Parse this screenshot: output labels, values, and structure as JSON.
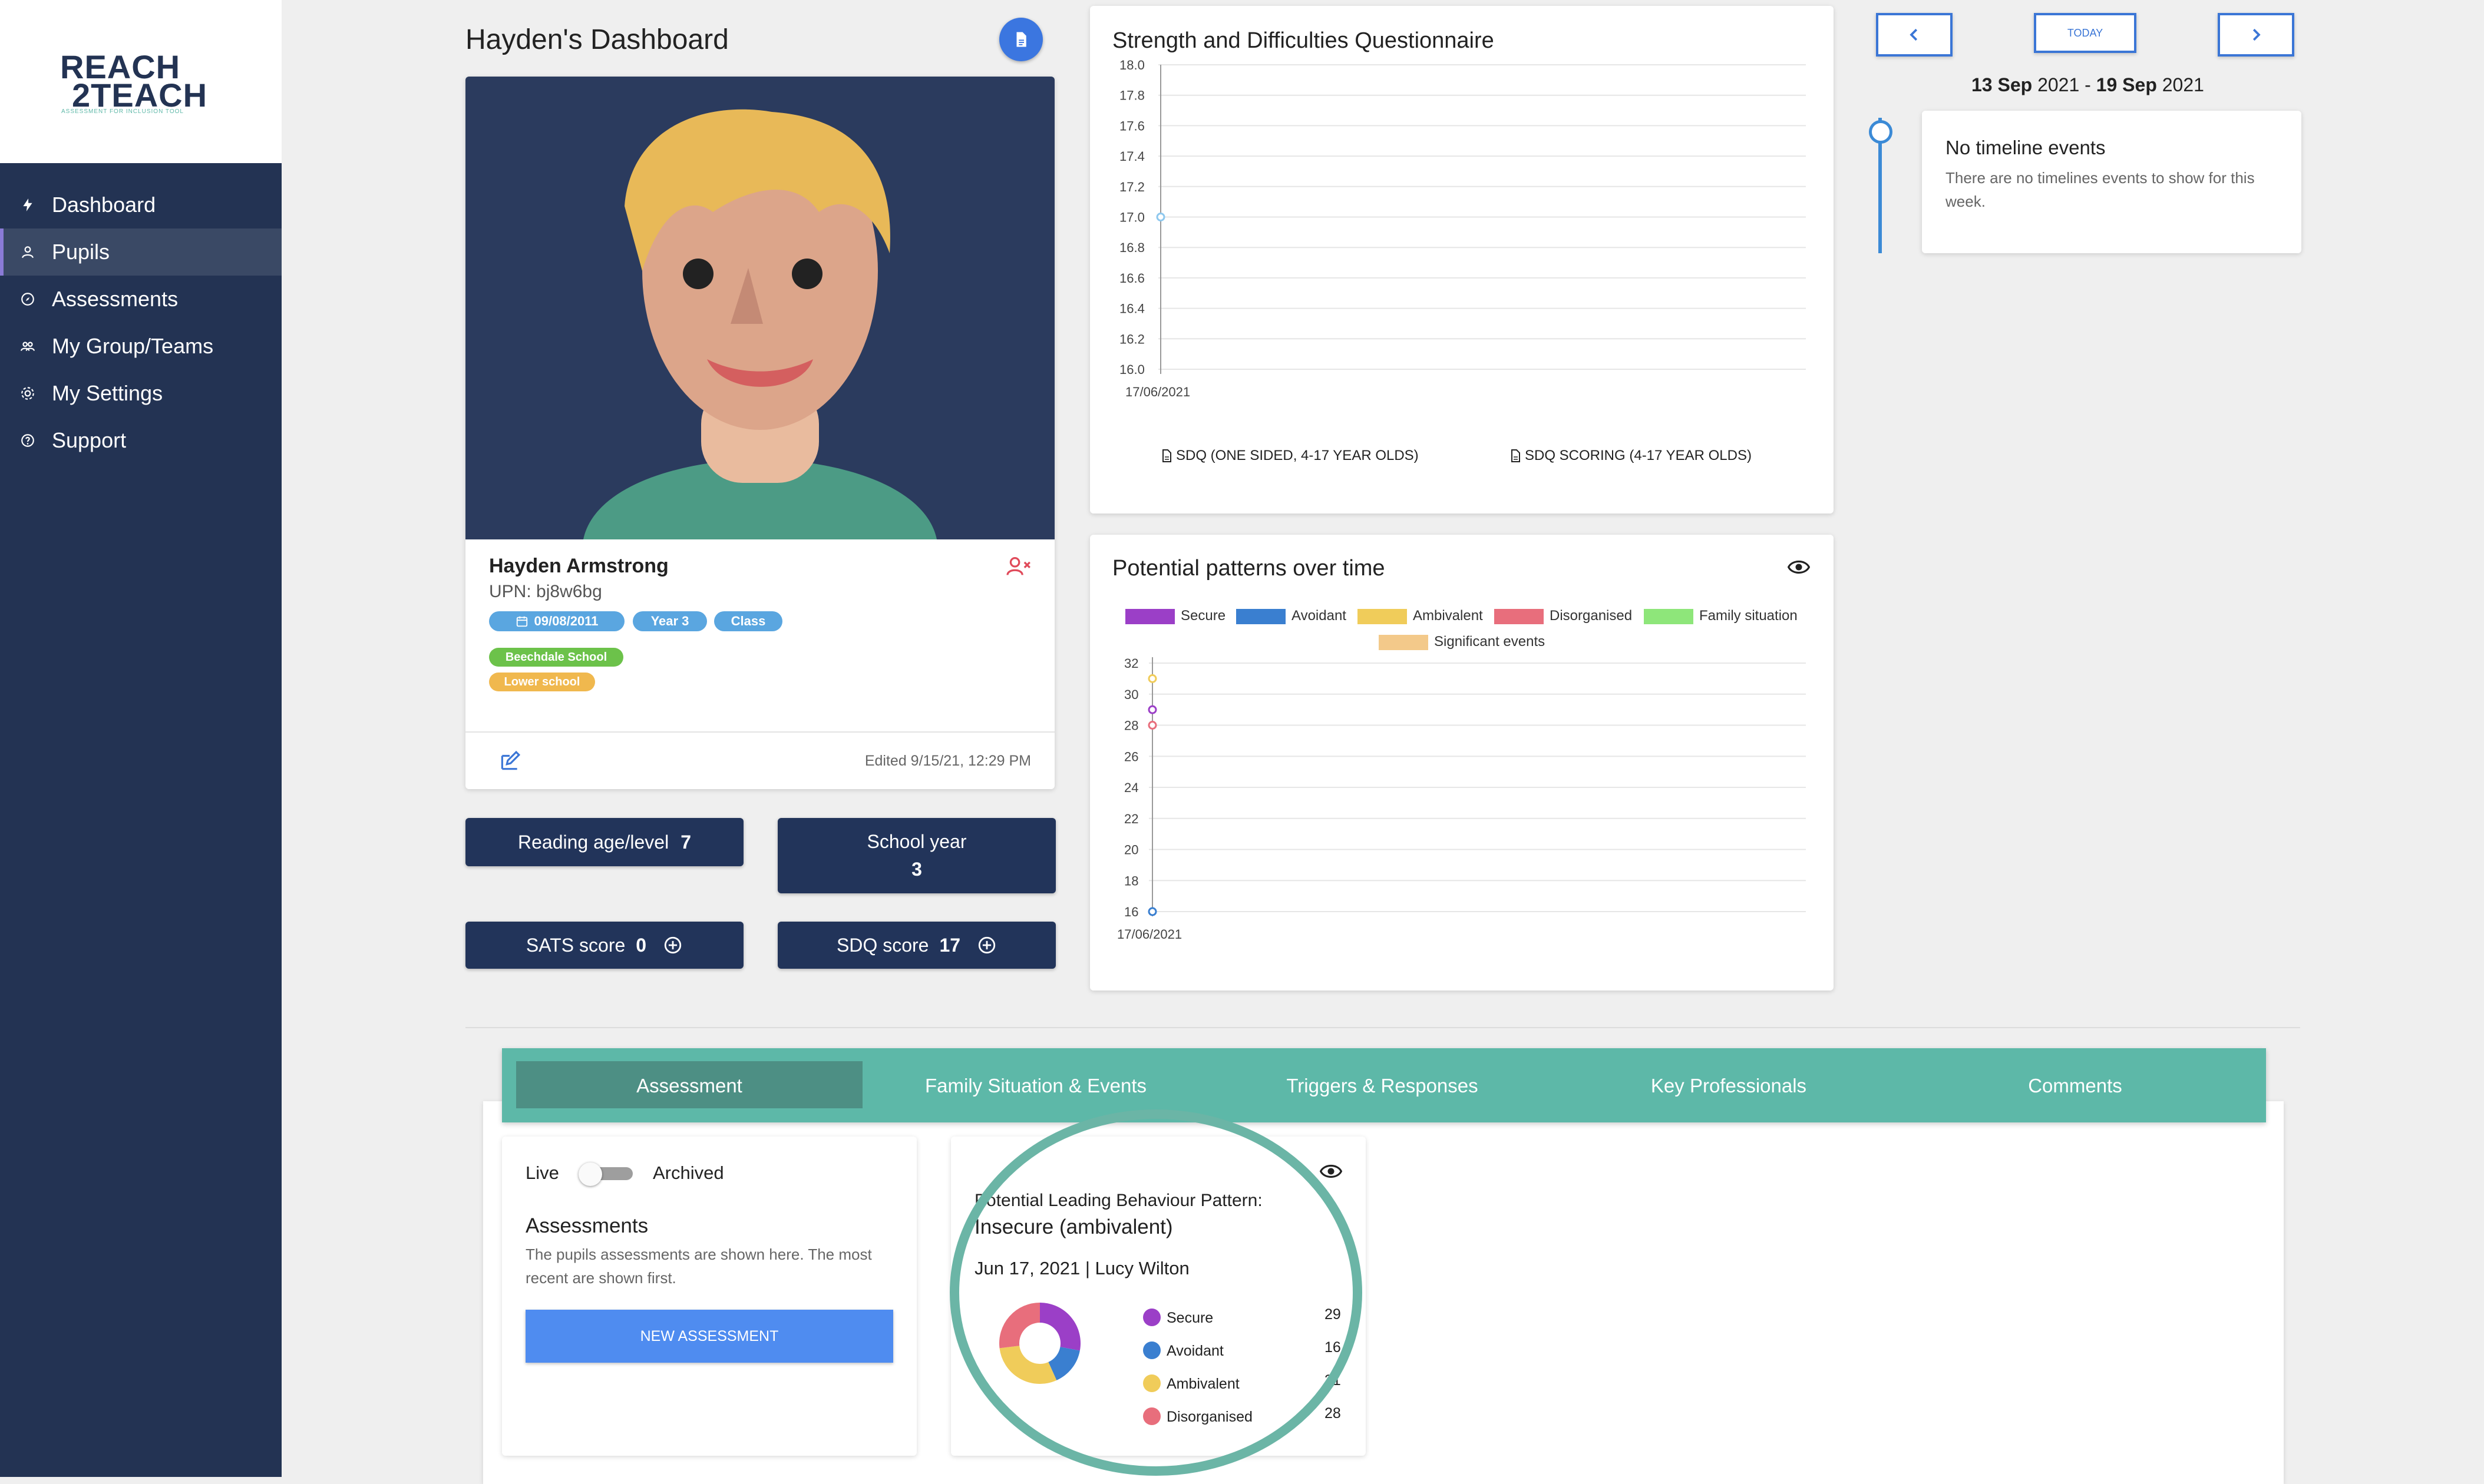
{
  "logo": {
    "line1": "REACH",
    "line2": "2TEACH",
    "tagline": "ASSESSMENT FOR INCLUSION TOOL"
  },
  "sidebar": {
    "items": [
      {
        "label": "Dashboard",
        "icon": "bolt-icon"
      },
      {
        "label": "Pupils",
        "icon": "person-icon",
        "active": true
      },
      {
        "label": "Assessments",
        "icon": "compass-icon"
      },
      {
        "label": "My Group/Teams",
        "icon": "group-icon"
      },
      {
        "label": "My Settings",
        "icon": "gear-icon"
      },
      {
        "label": "Support",
        "icon": "help-circle-icon"
      }
    ]
  },
  "page_title": "Hayden's Dashboard",
  "profile": {
    "name": "Hayden Armstrong",
    "upn": "UPN: bj8w6bg",
    "dob": "09/08/2011",
    "year": "Year 3",
    "class": "Class",
    "school": "Beechdale School",
    "phase": "Lower school",
    "edited": "Edited 9/15/21, 12:29 PM"
  },
  "stats": {
    "reading_label": "Reading age/level",
    "reading_value": "7",
    "school_year_label": "School year",
    "school_year_value": "3",
    "sats_label": "SATS score",
    "sats_value": "0",
    "sdq_label": "SDQ score",
    "sdq_value": "17"
  },
  "sdq_chart": {
    "title": "Strength and Difficulties Questionnaire",
    "link1": "SDQ (ONE SIDED, 4-17 YEAR OLDS)",
    "link2": "SDQ SCORING (4-17 YEAR OLDS)"
  },
  "patterns_chart": {
    "title": "Potential patterns over time",
    "legend": [
      {
        "name": "Secure",
        "color": "#9b3fc7"
      },
      {
        "name": "Avoidant",
        "color": "#3a7fd0"
      },
      {
        "name": "Ambivalent",
        "color": "#f0cc5a"
      },
      {
        "name": "Disorganised",
        "color": "#e86e7c"
      },
      {
        "name": "Family situation",
        "color": "#8ee67a"
      },
      {
        "name": "Significant events",
        "color": "#f3c98a"
      }
    ]
  },
  "chart_data": [
    {
      "type": "line",
      "title": "Strength and Difficulties Questionnaire",
      "x": [
        "17/06/2021"
      ],
      "series": [
        {
          "values": [
            17
          ]
        }
      ],
      "ylim": [
        16.0,
        18.0
      ],
      "yticks": [
        "18.0",
        "17.8",
        "17.6",
        "17.4",
        "17.2",
        "17.0",
        "16.8",
        "16.6",
        "16.4",
        "16.2",
        "16.0"
      ],
      "grid": true
    },
    {
      "type": "scatter",
      "title": "Potential patterns over time",
      "x": [
        "17/06/2021"
      ],
      "series": [
        {
          "name": "Secure",
          "values": [
            29
          ]
        },
        {
          "name": "Avoidant",
          "values": [
            16
          ]
        },
        {
          "name": "Ambivalent",
          "values": [
            31
          ]
        },
        {
          "name": "Disorganised",
          "values": [
            28
          ]
        }
      ],
      "ylim": [
        16,
        32
      ],
      "yticks": [
        "32",
        "30",
        "28",
        "26",
        "24",
        "22",
        "20",
        "18",
        "16"
      ],
      "legend": "top",
      "grid": true
    },
    {
      "type": "pie",
      "categories": [
        "Secure",
        "Avoidant",
        "Ambivalent",
        "Disorganised"
      ],
      "values": [
        29,
        16,
        31,
        28
      ]
    }
  ],
  "calendar": {
    "today": "TODAY",
    "range_start": "13 Sep",
    "range_start_year": "2021",
    "range_sep": " - ",
    "range_end": "19 Sep",
    "range_end_year": "2021",
    "event_title": "No timeline events",
    "event_text": "There are no timelines events to show for this week."
  },
  "tabs": [
    "Assessment",
    "Family Situation & Events",
    "Triggers & Responses",
    "Key Professionals",
    "Comments"
  ],
  "assessments_panel": {
    "live": "Live",
    "archived": "Archived",
    "title": "Assessments",
    "description": "The pupils assessments are shown here. The most recent are shown first.",
    "button": "NEW ASSESSMENT"
  },
  "behaviour_card": {
    "title_line1": "Potential Leading Behaviour Pattern:",
    "title_line2": "Insecure (ambivalent)",
    "meta": "Jun 17, 2021 | Lucy Wilton",
    "items": [
      {
        "label": "Secure",
        "value": "29",
        "color": "#9b3fc7"
      },
      {
        "label": "Avoidant",
        "value": "16",
        "color": "#3a7fd0"
      },
      {
        "label": "Ambivalent",
        "value": "31",
        "color": "#f0cc5a"
      },
      {
        "label": "Disorganised",
        "value": "28",
        "color": "#e86e7c"
      }
    ]
  }
}
